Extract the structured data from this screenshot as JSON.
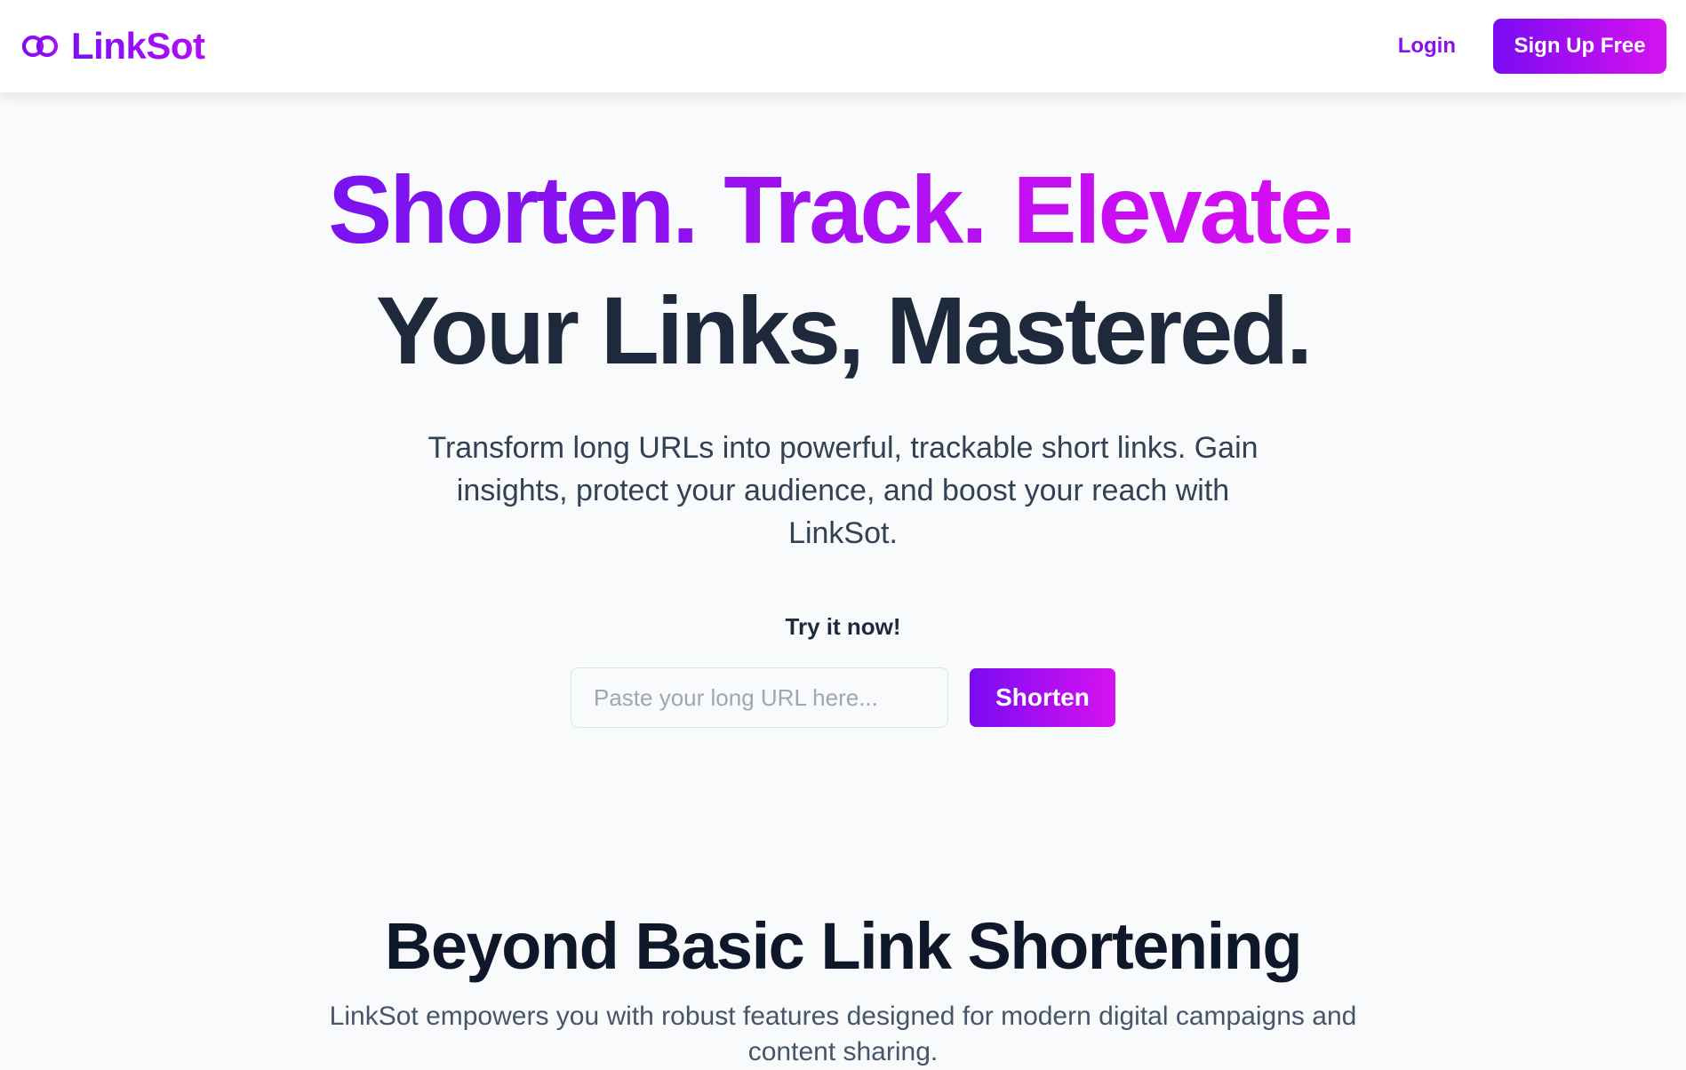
{
  "header": {
    "brand_icon": "infinity-link-icon",
    "brand_name": "LinkSot",
    "login_label": "Login",
    "signup_label": "Sign Up Free"
  },
  "hero": {
    "headline_words": [
      "Shorten.",
      "Track.",
      "Elevate."
    ],
    "subheadline": "Your Links, Mastered.",
    "description": "Transform long URLs into powerful, trackable short links. Gain insights, protect your audience, and boost your reach with LinkSot.",
    "try_label": "Try it now!",
    "input_value": "",
    "input_placeholder": "Paste your long URL here...",
    "shorten_label": "Shorten"
  },
  "features": {
    "title": "Beyond Basic Link Shortening",
    "description": "LinkSot empowers you with robust features designed for modern digital campaigns and content sharing."
  },
  "colors": {
    "brand_gradient_start": "#7a0bf2",
    "brand_gradient_end": "#d612f0",
    "dark_text": "#1e293b",
    "body_text": "#334155",
    "page_background": "#f8fafc"
  }
}
